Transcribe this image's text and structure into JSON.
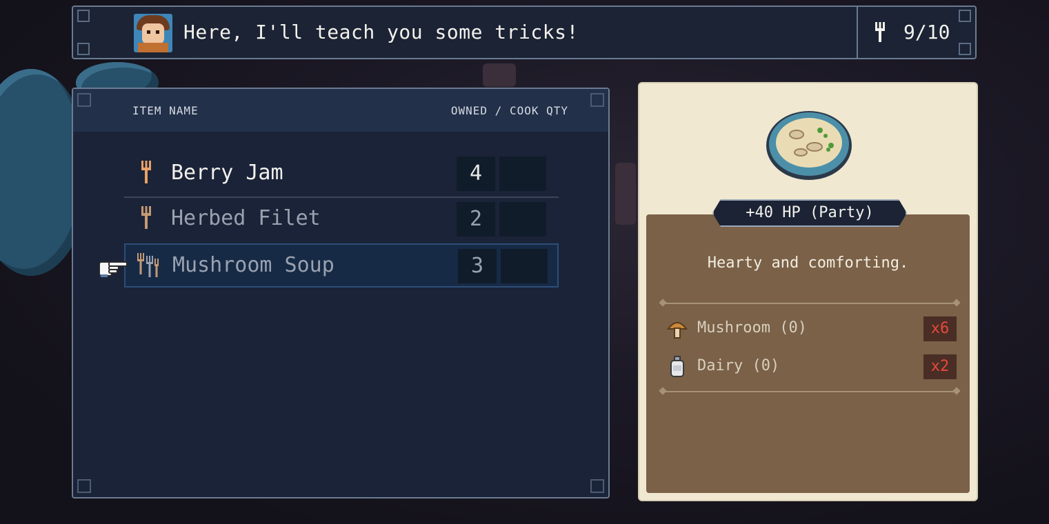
{
  "dialog": {
    "text": "Here, I'll teach you some tricks!",
    "counter_icon": "fork-icon",
    "counter": "9/10"
  },
  "list": {
    "header_left": "ITEM NAME",
    "header_right": "OWNED / COOK QTY",
    "items": [
      {
        "name": "Berry Jam",
        "owned": "4",
        "icon": "fork-icon",
        "state": "normal"
      },
      {
        "name": "Herbed Filet",
        "owned": "2",
        "icon": "fork-icon",
        "state": "dim"
      },
      {
        "name": "Mushroom Soup",
        "owned": "3",
        "icon": "multi-fork-icon",
        "state": "selected"
      }
    ]
  },
  "detail": {
    "icon": "soup-bowl-icon",
    "effect": "+40 HP (Party)",
    "description": "Hearty and comforting.",
    "ingredients": [
      {
        "name": "Mushroom (0)",
        "need": "x6",
        "icon": "mushroom-icon"
      },
      {
        "name": "Dairy (0)",
        "need": "x2",
        "icon": "milk-bottle-icon"
      }
    ]
  },
  "colors": {
    "panel_dark": "#1b2338",
    "panel_light": "#f1e8d2",
    "panel_brown": "#7a6148",
    "missing_red": "#e84a3c",
    "fork_orange": "#e9a267"
  }
}
